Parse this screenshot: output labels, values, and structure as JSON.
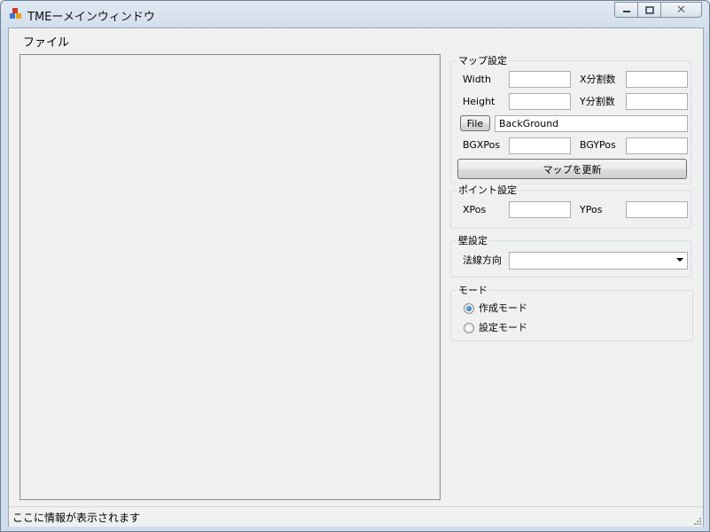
{
  "window": {
    "title": "TMEーメインウィンドウ",
    "close_glyph": "✕"
  },
  "menu": {
    "file": "ファイル"
  },
  "map_settings": {
    "legend": "マップ設定",
    "width_label": "Width",
    "x_div_label": "X分割数",
    "height_label": "Height",
    "y_div_label": "Y分割数",
    "file_button": "File",
    "file_value": "BackGround",
    "bgx_label": "BGXPos",
    "bgy_label": "BGYPos",
    "update_button": "マップを更新"
  },
  "point_settings": {
    "legend": "ポイント設定",
    "xpos_label": "XPos",
    "ypos_label": "YPos"
  },
  "wall_settings": {
    "legend": "壁設定",
    "normal_dir_label": "法線方向",
    "normal_dir_value": ""
  },
  "mode": {
    "legend": "モード",
    "options": [
      {
        "label": "作成モード",
        "selected": true
      },
      {
        "label": "設定モード",
        "selected": false
      }
    ]
  },
  "status": {
    "text": "ここに情報が表示されます"
  }
}
